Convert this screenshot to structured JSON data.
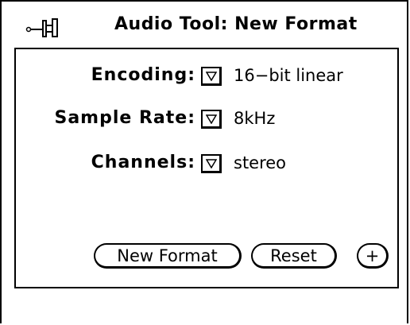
{
  "window": {
    "title": "Audio Tool: New Format"
  },
  "icons": {
    "pushpin": "pushpin-icon",
    "menu_arrow": "triangle-down-icon"
  },
  "form": {
    "encoding": {
      "label": "Encoding:",
      "value": "16−bit linear"
    },
    "sample_rate": {
      "label": "Sample Rate:",
      "value": "8kHz"
    },
    "channels": {
      "label": "Channels:",
      "value": "stereo"
    }
  },
  "buttons": {
    "new_format": "New Format",
    "reset": "Reset",
    "plus": "+"
  },
  "colors": {
    "foreground": "#000000",
    "background": "#ffffff"
  }
}
